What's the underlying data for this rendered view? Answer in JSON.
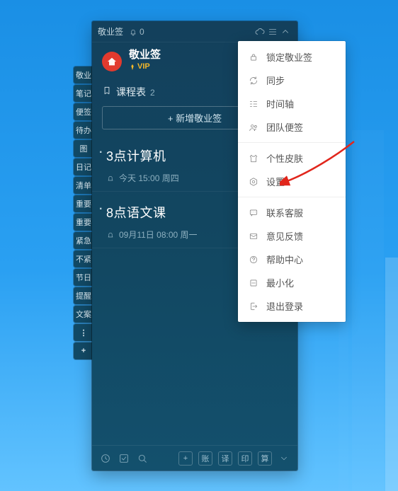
{
  "titlebar": {
    "app_name": "敬业签",
    "notification_count": "0"
  },
  "brand": {
    "name": "敬业签",
    "vip_label": "VIP"
  },
  "category": {
    "label": "课程表",
    "count": "2"
  },
  "add_button_label": "+ 新增敬业签",
  "notes": [
    {
      "title": "3点计算机",
      "meta": "今天 15:00 周四"
    },
    {
      "title": "8点语文课",
      "meta": "09月11日 08:00 周一"
    }
  ],
  "side_tabs": [
    "敬业",
    "笔记",
    "便签",
    "待办",
    "图",
    "日记",
    "清单",
    "重要",
    "重要",
    "紧急",
    "不紧",
    "节日",
    "提醒",
    "文案"
  ],
  "side_more": "⋮",
  "side_plus": "+",
  "menu": {
    "items_group1": [
      {
        "icon": "lock-icon",
        "label": "锁定敬业签"
      },
      {
        "icon": "sync-icon",
        "label": "同步"
      },
      {
        "icon": "timeline-icon",
        "label": "时间轴"
      },
      {
        "icon": "team-icon",
        "label": "团队便签"
      }
    ],
    "items_group2": [
      {
        "icon": "skin-icon",
        "label": "个性皮肤"
      },
      {
        "icon": "settings-icon",
        "label": "设置"
      }
    ],
    "items_group3": [
      {
        "icon": "chat-icon",
        "label": "联系客服"
      },
      {
        "icon": "mail-icon",
        "label": "意见反馈"
      },
      {
        "icon": "help-icon",
        "label": "帮助中心"
      },
      {
        "icon": "minimize-icon",
        "label": "最小化"
      },
      {
        "icon": "logout-icon",
        "label": "退出登录"
      }
    ]
  },
  "bottombar": {
    "chips": [
      "+",
      "账",
      "译",
      "印",
      "算"
    ]
  }
}
